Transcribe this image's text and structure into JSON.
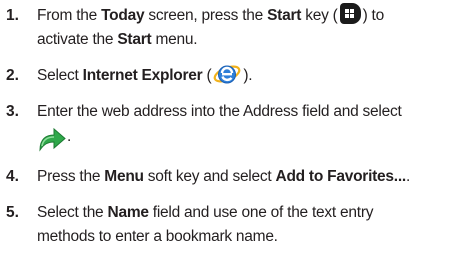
{
  "steps": [
    {
      "number": "1.",
      "lines": [
        [
          "From the ",
          "Today",
          " screen, press the ",
          "Start",
          " key (",
          ") to"
        ],
        [
          "activate the ",
          "Start",
          " menu."
        ]
      ]
    },
    {
      "number": "2.",
      "lines": [
        [
          "Select ",
          "Internet Explorer",
          " (",
          ")."
        ]
      ]
    },
    {
      "number": "3.",
      "lines": [
        [
          "Enter the web address into the Address field and select"
        ],
        [
          "."
        ]
      ]
    },
    {
      "number": "4.",
      "lines": [
        [
          "Press the ",
          "Menu",
          " soft key and select ",
          "Add to Favorites...",
          "."
        ]
      ]
    },
    {
      "number": "5.",
      "lines": [
        [
          "Select the ",
          "Name",
          " field and use one of the text entry"
        ],
        [
          "methods to enter a bookmark name."
        ]
      ]
    }
  ],
  "icons": {
    "start_key": "windows-start-key-icon",
    "internet_explorer": "internet-explorer-icon",
    "go": "green-go-arrow-icon"
  },
  "colors": {
    "text": "#231f20",
    "ie_blue": "#2f7fd8",
    "ie_ring": "#f2b21b",
    "go_green": "#2fa84a"
  }
}
